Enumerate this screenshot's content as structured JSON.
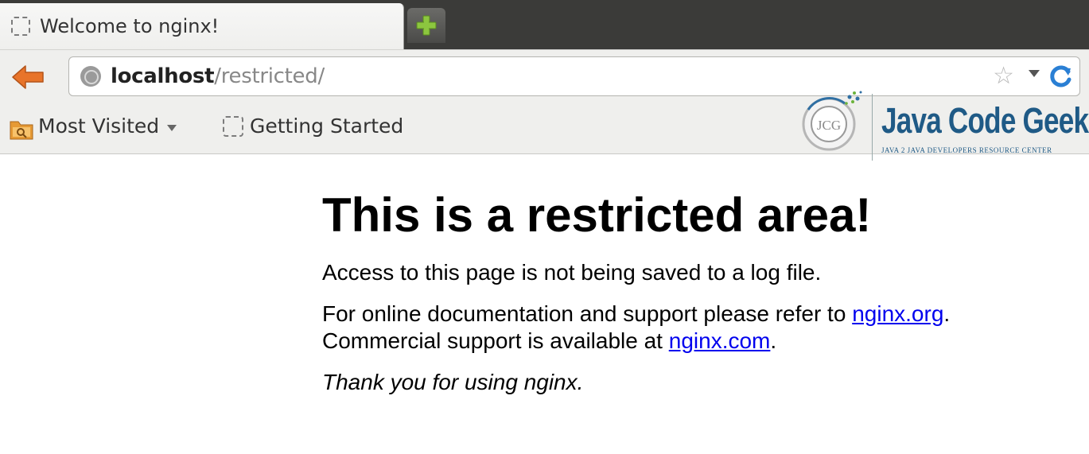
{
  "tab": {
    "title": "Welcome to nginx!"
  },
  "urlbar": {
    "host": "localhost",
    "path": "/restricted/"
  },
  "bookmarks": {
    "most_visited": "Most Visited",
    "getting_started": "Getting Started"
  },
  "logo": {
    "emblem": "JCG",
    "wordmark": "Java Code Geeks",
    "tagline": "Java 2 Java Developers Resource Center"
  },
  "page": {
    "heading": "This is a restricted area!",
    "access_note": "Access to this page is not being saved to a log file.",
    "doc_text": "For online documentation and support please refer to ",
    "doc_link": "nginx.org",
    "doc_end": ".",
    "commercial_text": "Commercial support is available at ",
    "commercial_link": "nginx.com",
    "commercial_end": ".",
    "thanks": "Thank you for using nginx."
  },
  "colors": {
    "link": "#0000ee",
    "tabbar": "#3b3b39",
    "back_arrow": "#e8742a",
    "newtab_plus": "#8cc63f",
    "reload": "#2a7fd4",
    "logo_blue": "#1f5a86"
  }
}
